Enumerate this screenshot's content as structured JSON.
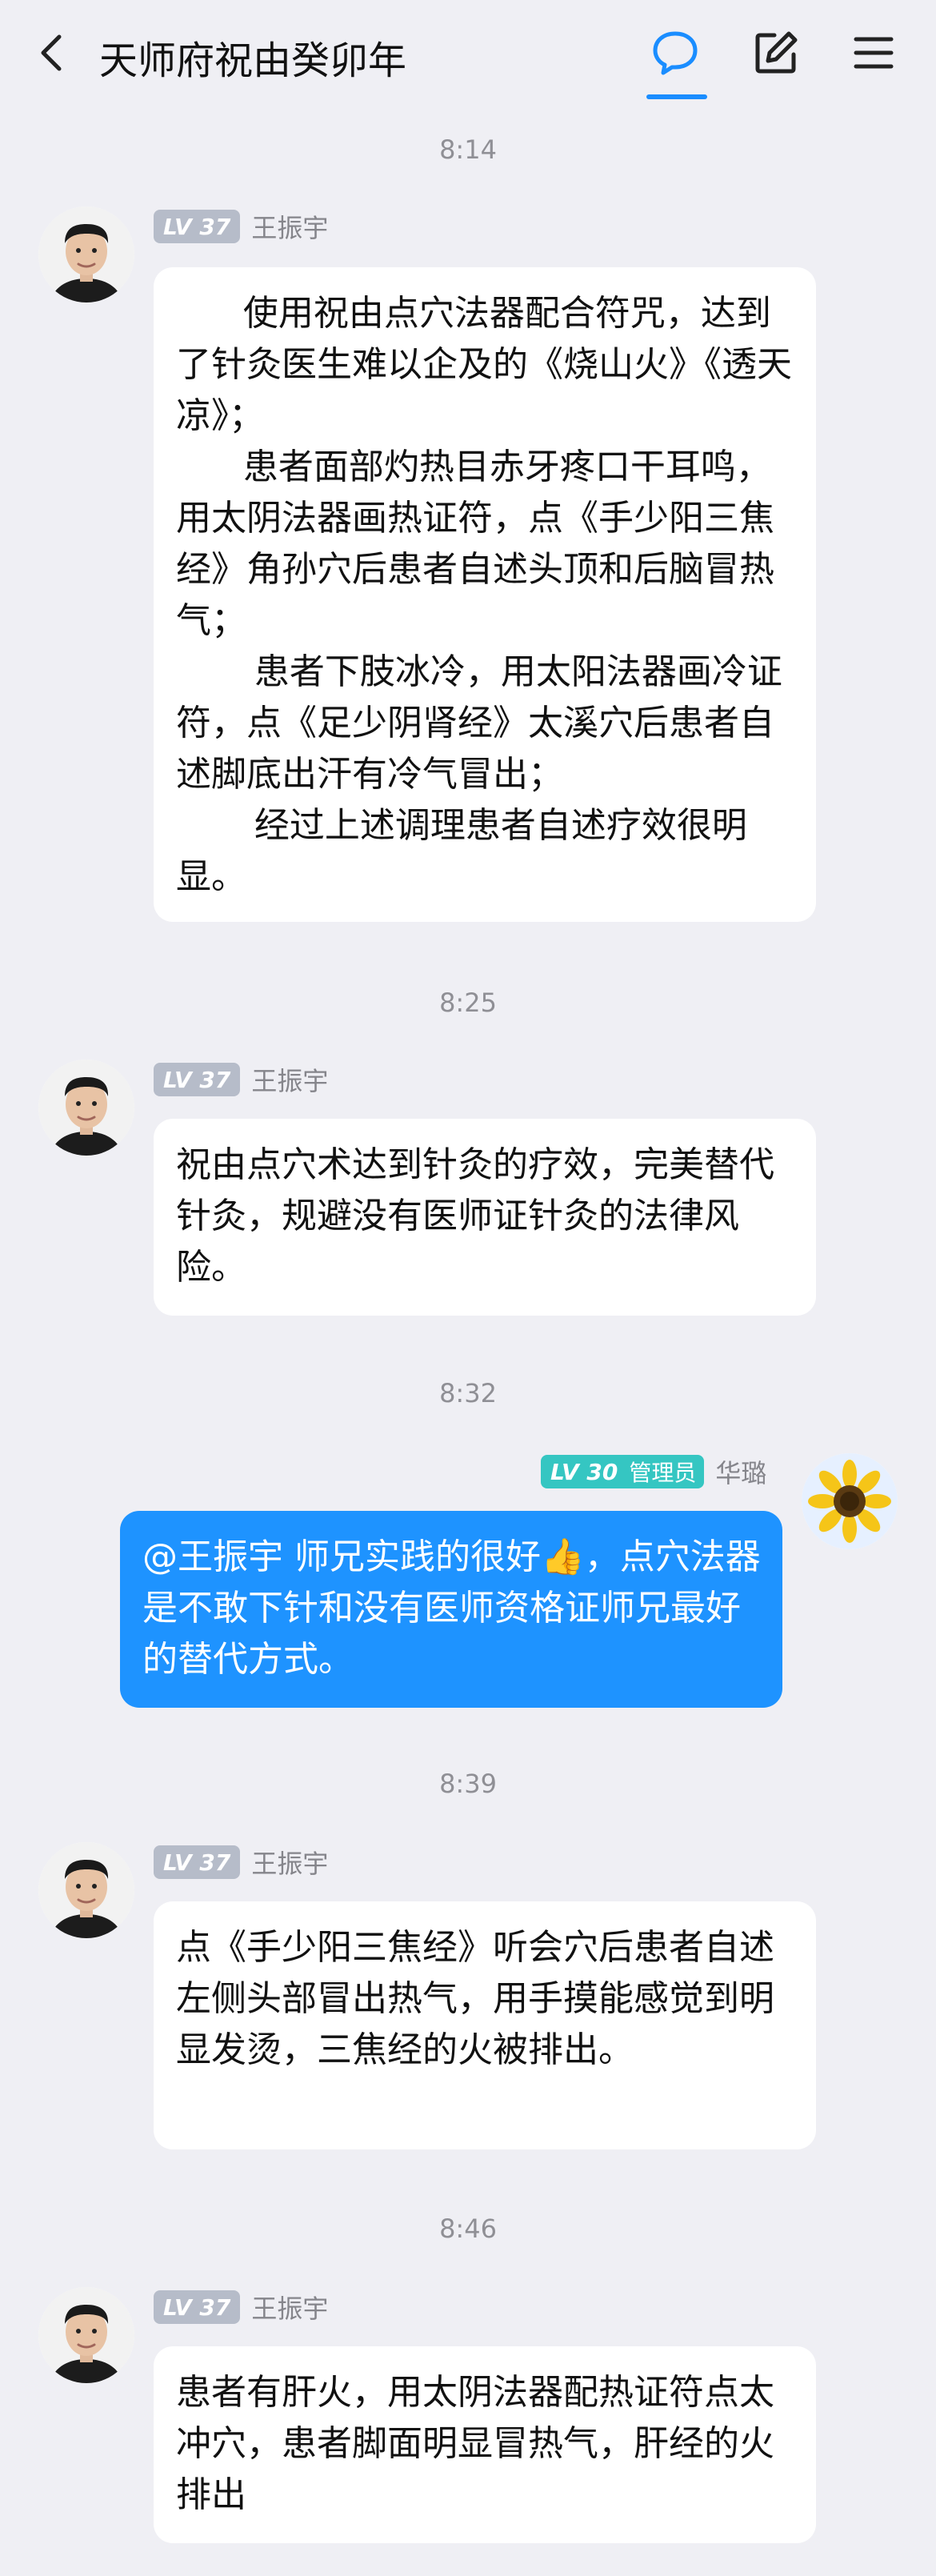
{
  "header": {
    "title": "天师府祝由癸卯年"
  },
  "messages": [
    {
      "time": "8:14",
      "level": "LV 37",
      "sender": "王振宇",
      "text": "      使用祝由点穴法器配合符咒，达到了针灸医生难以企及的《烧山火》《透天凉》；\n      患者面部灼热目赤牙疼口干耳鸣，用太阴法器画热证符，点《手少阳三焦经》角孙穴后患者自述头顶和后脑冒热气；\n       患者下肢冰冷，用太阳法器画冷证符，点《足少阴肾经》太溪穴后患者自述脚底出汗有冷气冒出；\n       经过上述调理患者自述疗效很明显。"
    },
    {
      "time": "8:25",
      "level": "LV 37",
      "sender": "王振宇",
      "text": "祝由点穴术达到针灸的疗效，完美替代针灸，规避没有医师证针灸的法律风险。"
    },
    {
      "time": "8:32",
      "level": "LV 30",
      "role": "管理员",
      "sender": "华璐",
      "text": "@王振宇 师兄实践的很好👍，点穴法器是不敢下针和没有医师资格证师兄最好的替代方式。"
    },
    {
      "time": "8:39",
      "level": "LV 37",
      "sender": "王振宇",
      "text": "点《手少阳三焦经》听会穴后患者自述左侧头部冒出热气，用手摸能感觉到明显发烫，三焦经的火被排出。"
    },
    {
      "time": "8:46",
      "level": "LV 37",
      "sender": "王振宇",
      "text": "患者有肝火，用太阴法器配热证符点太冲穴，患者脚面明显冒热气，肝经的火排出"
    }
  ],
  "icons": {
    "back": "back-arrow-icon",
    "chat": "chat-bubble-icon",
    "edit": "edit-icon",
    "menu": "hamburger-menu-icon"
  },
  "colors": {
    "accent": "#1a8dff",
    "my_bubble": "#1e93ff",
    "admin_badge": "#35c6c2",
    "level_badge": "#b6bcc9",
    "background": "#efeff4"
  }
}
